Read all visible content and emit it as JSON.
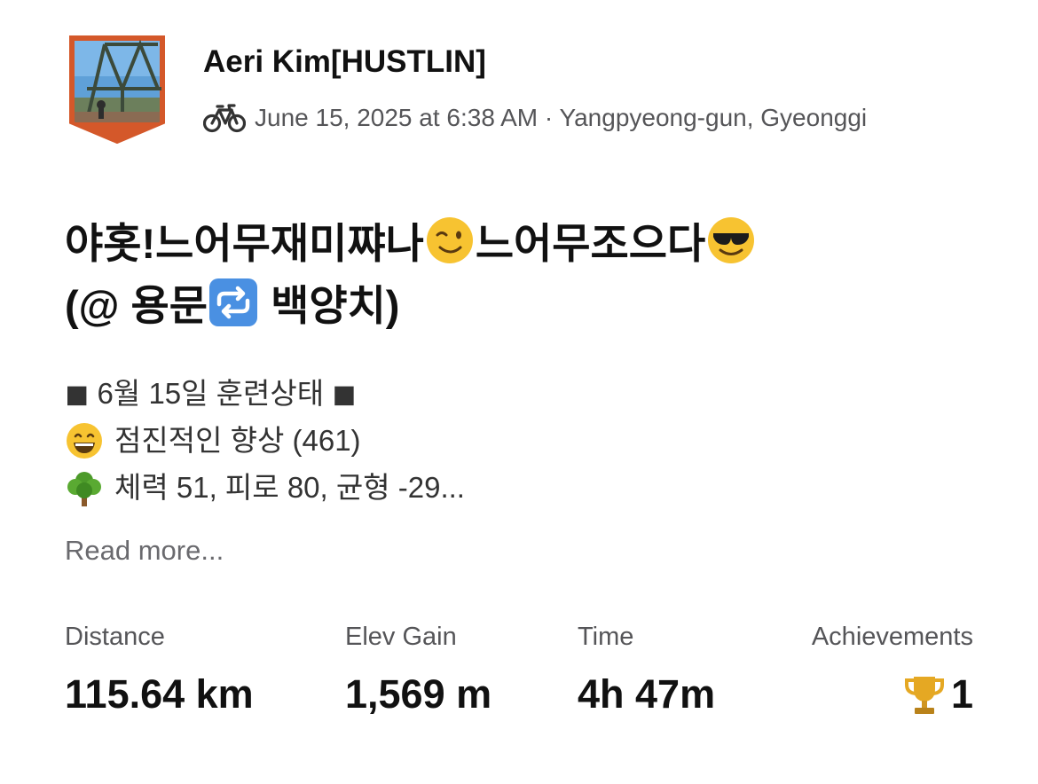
{
  "athlete": {
    "name": "Aeri  Kim[HUSTLIN]",
    "avatar_icon": "athlete-avatar-bridge-photo",
    "shield_color": "#d4582a"
  },
  "activity": {
    "type_icon": "bike-icon",
    "datetime_location": "June 15, 2025 at 6:38 AM · Yangpyeong-gun, Gyeonggi",
    "title": {
      "part1": "야홋!느어무재미쨔나",
      "emoji1": "winking-face-emoji",
      "part2": "느어무조으다",
      "emoji2": "sunglasses-face-emoji",
      "part3": "(@ 용문",
      "emoji3": "repeat-arrows-emoji",
      "part4": " 백양치)"
    },
    "description": {
      "line1": "◼ 6월 15일 훈련상태 ◼",
      "line2": "점진적인 향상 (461)",
      "line2_icon": "grinning-face-emoji",
      "line3": "체력 51, 피로 80, 균형 -29...",
      "line3_icon": "tree-emoji"
    },
    "read_more": "Read more..."
  },
  "stats": {
    "distance": {
      "label": "Distance",
      "value": "115.64 km"
    },
    "elev_gain": {
      "label": "Elev Gain",
      "value": "1,569 m"
    },
    "time": {
      "label": "Time",
      "value": "4h 47m"
    },
    "achievements": {
      "label": "Achievements",
      "value": "1",
      "icon": "trophy-icon"
    }
  },
  "colors": {
    "text_primary": "#111111",
    "text_secondary": "#555558",
    "trophy_gold": "#e5a823"
  }
}
